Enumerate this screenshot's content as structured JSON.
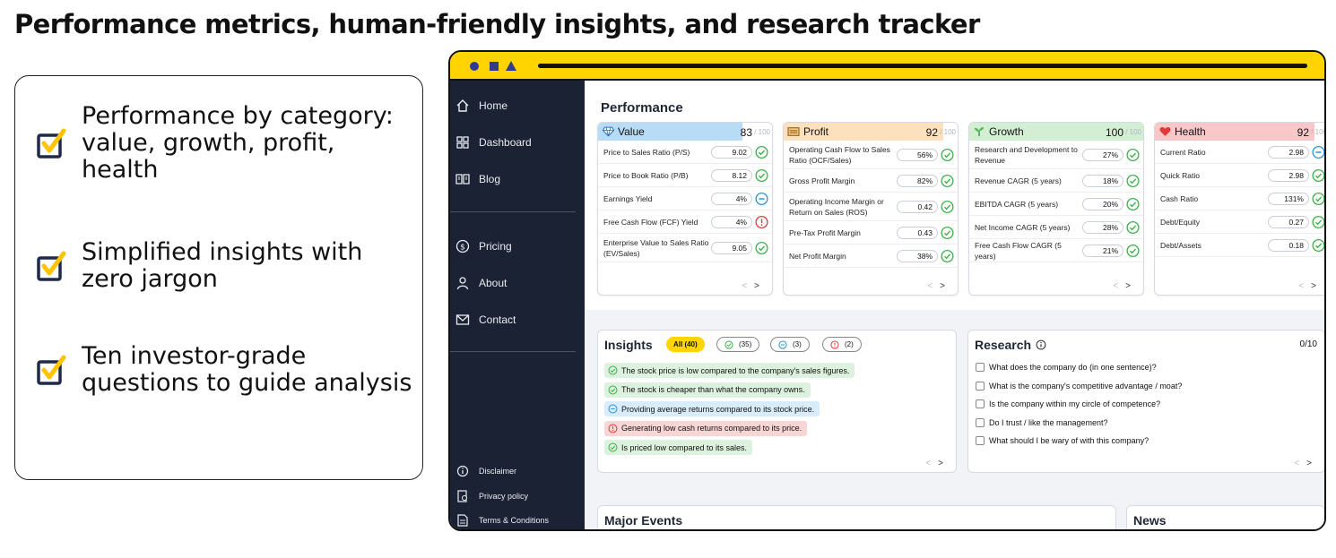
{
  "headline": "Performance metrics, human-friendly insights, and research tracker",
  "features": [
    {
      "icon": "checkbox-checked-icon",
      "text": "Performance by category: value, growth, profit, health"
    },
    {
      "icon": "checkbox-checked-icon",
      "text": "Simplified insights with zero jargon"
    },
    {
      "icon": "checkbox-checked-icon",
      "text": "Ten investor-grade questions to guide analysis"
    }
  ],
  "colors": {
    "accent_yellow": "#ffd400",
    "sidebar_bg": "#1b2233",
    "value_blue": "#b8dcf5",
    "profit_orange": "#fde0bd",
    "growth_green": "#d3efd3",
    "health_red": "#f8c7c7",
    "check_green": "#3cb24a",
    "neutral_blue": "#2d96d6",
    "warn_red": "#e03b3b"
  },
  "sidebar": {
    "nav": [
      {
        "label": "Home",
        "icon": "home-icon"
      },
      {
        "label": "Dashboard",
        "icon": "grid-icon"
      },
      {
        "label": "Blog",
        "icon": "book-icon"
      },
      {
        "label": "Pricing",
        "icon": "dollar-icon"
      },
      {
        "label": "About",
        "icon": "person-icon"
      },
      {
        "label": "Contact",
        "icon": "mail-icon"
      }
    ],
    "footer": [
      {
        "label": "Disclaimer",
        "icon": "info-icon"
      },
      {
        "label": "Privacy policy",
        "icon": "shield-doc-icon"
      },
      {
        "label": "Terms & Conditions",
        "icon": "document-icon"
      }
    ]
  },
  "performance": {
    "title": "Performance",
    "cards": [
      {
        "name": "Value",
        "icon": "diamond-icon",
        "score": "83",
        "max": "/ 100",
        "score_pct": 83,
        "metrics": [
          {
            "name": "Price to Sales Ratio (P/S)",
            "value": "9.02",
            "status": "good"
          },
          {
            "name": "Price to Book Ratio (P/B)",
            "value": "8.12",
            "status": "good"
          },
          {
            "name": "Earnings Yield",
            "value": "4%",
            "status": "neutral"
          },
          {
            "name": "Free Cash Flow (FCF) Yield",
            "value": "4%",
            "status": "bad"
          },
          {
            "name": "Enterprise Value to Sales Ratio (EV/Sales)",
            "value": "9.05",
            "status": "good"
          }
        ]
      },
      {
        "name": "Profit",
        "icon": "money-icon",
        "score": "92",
        "max": "/ 100",
        "score_pct": 92,
        "metrics": [
          {
            "name": "Operating Cash Flow to Sales Ratio (OCF/Sales)",
            "value": "56%",
            "status": "good"
          },
          {
            "name": "Gross Profit Margin",
            "value": "82%",
            "status": "good"
          },
          {
            "name": "Operating Income Margin or Return on Sales (ROS)",
            "value": "0.42",
            "status": "good"
          },
          {
            "name": "Pre-Tax Profit Margin",
            "value": "0.43",
            "status": "good"
          },
          {
            "name": "Net Profit Margin",
            "value": "38%",
            "status": "good"
          }
        ]
      },
      {
        "name": "Growth",
        "icon": "sprout-icon",
        "score": "100",
        "max": "/ 100",
        "score_pct": 100,
        "metrics": [
          {
            "name": "Research and Development to Revenue",
            "value": "27%",
            "status": "good"
          },
          {
            "name": "Revenue CAGR (5 years)",
            "value": "18%",
            "status": "good"
          },
          {
            "name": "EBITDA CAGR (5 years)",
            "value": "20%",
            "status": "good"
          },
          {
            "name": "Net Income CAGR (5 years)",
            "value": "28%",
            "status": "good"
          },
          {
            "name": "Free Cash Flow CAGR (5 years)",
            "value": "21%",
            "status": "good"
          }
        ]
      },
      {
        "name": "Health",
        "icon": "heart-icon",
        "score": "92",
        "max": "/ 100",
        "score_pct": 92,
        "metrics": [
          {
            "name": "Current Ratio",
            "value": "2.98",
            "status": "neutral"
          },
          {
            "name": "Quick Ratio",
            "value": "2.98",
            "status": "good"
          },
          {
            "name": "Cash Ratio",
            "value": "131%",
            "status": "good"
          },
          {
            "name": "Debt/Equity",
            "value": "0.27",
            "status": "good"
          },
          {
            "name": "Debt/Assets",
            "value": "0.18",
            "status": "good"
          }
        ]
      }
    ]
  },
  "insights": {
    "title": "Insights",
    "filters": [
      {
        "label": "All (40)",
        "kind": "all"
      },
      {
        "label": "(35)",
        "kind": "good"
      },
      {
        "label": "(3)",
        "kind": "neutral"
      },
      {
        "label": "(2)",
        "kind": "bad"
      }
    ],
    "items": [
      {
        "text": "The stock price is low compared to the company's sales figures.",
        "kind": "good"
      },
      {
        "text": "The stock is cheaper than what the company owns.",
        "kind": "good"
      },
      {
        "text": "Providing average returns compared to its stock price.",
        "kind": "neutral"
      },
      {
        "text": "Generating low cash returns compared to its price.",
        "kind": "bad"
      },
      {
        "text": "Is priced low compared to its sales.",
        "kind": "good"
      }
    ]
  },
  "research": {
    "title": "Research",
    "count": "0/10",
    "questions": [
      "What does the company do (in one sentence)?",
      "What is the company's competitive advantage / moat?",
      "Is the company within my circle of competence?",
      "Do I trust / like the management?",
      "What should I be wary of with this company?"
    ]
  },
  "pager": {
    "prev": "<",
    "next": ">"
  },
  "events": {
    "title": "Major Events"
  },
  "news": {
    "title": "News"
  }
}
